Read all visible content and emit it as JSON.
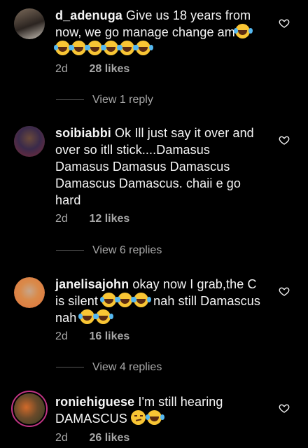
{
  "comments": [
    {
      "username": "d_adenuga",
      "text": "Give us 18 years from now, we go manage change am",
      "emojis_inline": [
        "laugh"
      ],
      "emojis_line": [
        "laugh",
        "laugh",
        "laugh",
        "laugh",
        "laugh",
        "laugh"
      ],
      "time": "2d",
      "likes": "28 likes",
      "replies": "View 1 reply"
    },
    {
      "username": "soibiabbi",
      "text": "Ok Ill just say it over and over so itll stick....Damasus Damasus Damasus Damascus Damascus Damascus. chaii e go hard",
      "time": "2d",
      "likes": "12 likes",
      "replies": "View 6 replies"
    },
    {
      "username": "janelisajohn",
      "text_1": "okay now I grab,the C is silent",
      "text_2": "nah still Damascus nah",
      "time": "2d",
      "likes": "16 likes",
      "replies": "View 4 replies"
    },
    {
      "username": "roniehiguese",
      "text": "I'm still hearing DAMASCUS",
      "time": "2d",
      "likes": "26 likes"
    }
  ],
  "icons": {
    "like": "heart-outline-icon",
    "emoji_laugh": "face-with-tears-of-joy",
    "emoji_smirk": "smirking-face"
  },
  "colors": {
    "background": "#000000",
    "text": "#f5f5f5",
    "muted": "#a8a8a8",
    "story_ring": "#c13584"
  }
}
